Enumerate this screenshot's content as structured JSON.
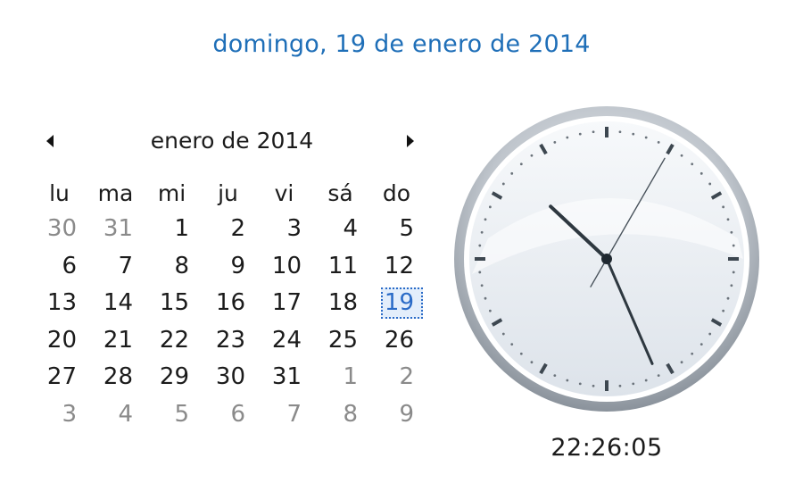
{
  "header": {
    "full_date": "domingo, 19 de enero de 2014"
  },
  "calendar": {
    "month_label": "enero de 2014",
    "weekdays": [
      "lu",
      "ma",
      "mi",
      "ju",
      "vi",
      "sá",
      "do"
    ],
    "weeks": [
      [
        {
          "d": "30",
          "o": true
        },
        {
          "d": "31",
          "o": true
        },
        {
          "d": "1"
        },
        {
          "d": "2"
        },
        {
          "d": "3"
        },
        {
          "d": "4"
        },
        {
          "d": "5"
        }
      ],
      [
        {
          "d": "6"
        },
        {
          "d": "7"
        },
        {
          "d": "8"
        },
        {
          "d": "9"
        },
        {
          "d": "10"
        },
        {
          "d": "11"
        },
        {
          "d": "12"
        }
      ],
      [
        {
          "d": "13"
        },
        {
          "d": "14"
        },
        {
          "d": "15"
        },
        {
          "d": "16"
        },
        {
          "d": "17"
        },
        {
          "d": "18"
        },
        {
          "d": "19",
          "today": true
        }
      ],
      [
        {
          "d": "20"
        },
        {
          "d": "21"
        },
        {
          "d": "22"
        },
        {
          "d": "23"
        },
        {
          "d": "24"
        },
        {
          "d": "25"
        },
        {
          "d": "26"
        }
      ],
      [
        {
          "d": "27"
        },
        {
          "d": "28"
        },
        {
          "d": "29"
        },
        {
          "d": "30"
        },
        {
          "d": "31"
        },
        {
          "d": "1",
          "o": true
        },
        {
          "d": "2",
          "o": true
        }
      ],
      [
        {
          "d": "3",
          "o": true
        },
        {
          "d": "4",
          "o": true
        },
        {
          "d": "5",
          "o": true
        },
        {
          "d": "6",
          "o": true
        },
        {
          "d": "7",
          "o": true
        },
        {
          "d": "8",
          "o": true
        },
        {
          "d": "9",
          "o": true
        }
      ]
    ],
    "prev_icon": "triangle-left-icon",
    "next_icon": "triangle-right-icon"
  },
  "clock": {
    "time": "22:26:05",
    "hour": 22,
    "minute": 26,
    "second": 5
  },
  "colors": {
    "accent": "#1f6fb8",
    "today_border": "#2a6bc7",
    "other_month": "#8a8a8a"
  }
}
